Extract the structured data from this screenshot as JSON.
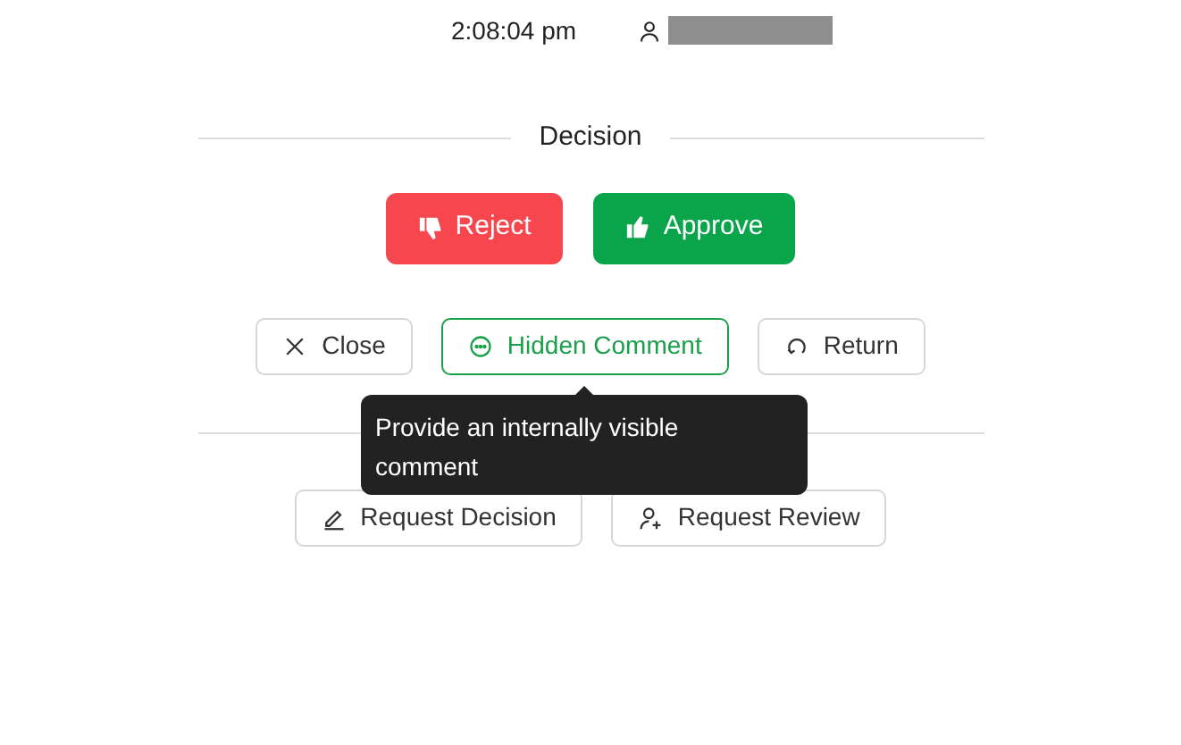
{
  "meta": {
    "time": "2:08:04 pm",
    "user_redacted": true
  },
  "decision": {
    "heading": "Decision",
    "buttons": [
      {
        "kind": "reject",
        "label": "Reject"
      },
      {
        "kind": "approve",
        "label": "Approve"
      }
    ]
  },
  "actions": [
    {
      "kind": "close",
      "label": "Close",
      "active": false
    },
    {
      "kind": "comment",
      "label": "Hidden Comment",
      "active": true
    },
    {
      "kind": "return",
      "label": "Return",
      "active": false
    }
  ],
  "tooltip": {
    "text": "Provide an internally visible comment"
  },
  "requests": [
    {
      "kind": "decision",
      "label": "Request Decision"
    },
    {
      "kind": "review",
      "label": "Request Review"
    }
  ]
}
